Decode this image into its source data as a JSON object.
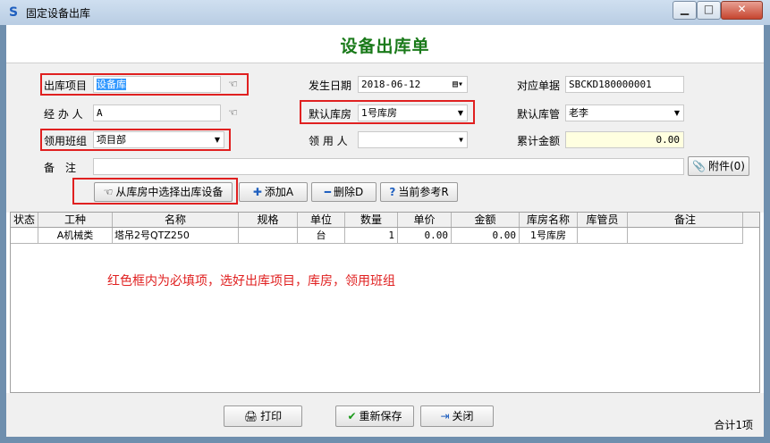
{
  "window": {
    "title": "固定设备出库",
    "min": "▁",
    "max": "□",
    "close": "✕"
  },
  "form": {
    "title": "设备出库单",
    "out_project": {
      "label": "出库项目",
      "value": "设备库"
    },
    "date": {
      "label": "发生日期",
      "value": "2018-06-12"
    },
    "ref_no": {
      "label": "对应单据",
      "value": "SBCKD180000001"
    },
    "handler": {
      "label": "经 办 人",
      "value": "A"
    },
    "default_store": {
      "label": "默认库房",
      "value": "1号库房"
    },
    "store_keeper": {
      "label": "默认库管",
      "value": "老李"
    },
    "team": {
      "label": "领用班组",
      "value": "项目部"
    },
    "receiver": {
      "label": "领 用 人",
      "value": ""
    },
    "total_amount": {
      "label": "累计金额",
      "value": "0.00"
    },
    "remark": {
      "label": "备　注",
      "value": ""
    },
    "attachment_button": "附件(0)"
  },
  "toolbar": {
    "select_from_store": "从库房中选择出库设备",
    "add": "添加A",
    "delete": "删除D",
    "reference": "当前参考R"
  },
  "grid": {
    "headers": [
      "状态",
      "工种",
      "名称",
      "规格",
      "单位",
      "数量",
      "单价",
      "金额",
      "库房名称",
      "库管员",
      "备注"
    ],
    "rows": [
      [
        "",
        "A机械类",
        "塔吊2号QTZ250",
        "",
        "台",
        "1",
        "0.00",
        "0.00",
        "1号库房",
        "",
        ""
      ]
    ]
  },
  "annotation": "红色框内为必填项，选好出库项目，库房，领用班组",
  "footer": {
    "print": "打印",
    "resave": "重新保存",
    "close": "关闭",
    "total": "合计1项"
  },
  "colors": {
    "title_green": "#1a7a1a",
    "required_red": "#e02020",
    "selection_blue": "#3399ff"
  }
}
